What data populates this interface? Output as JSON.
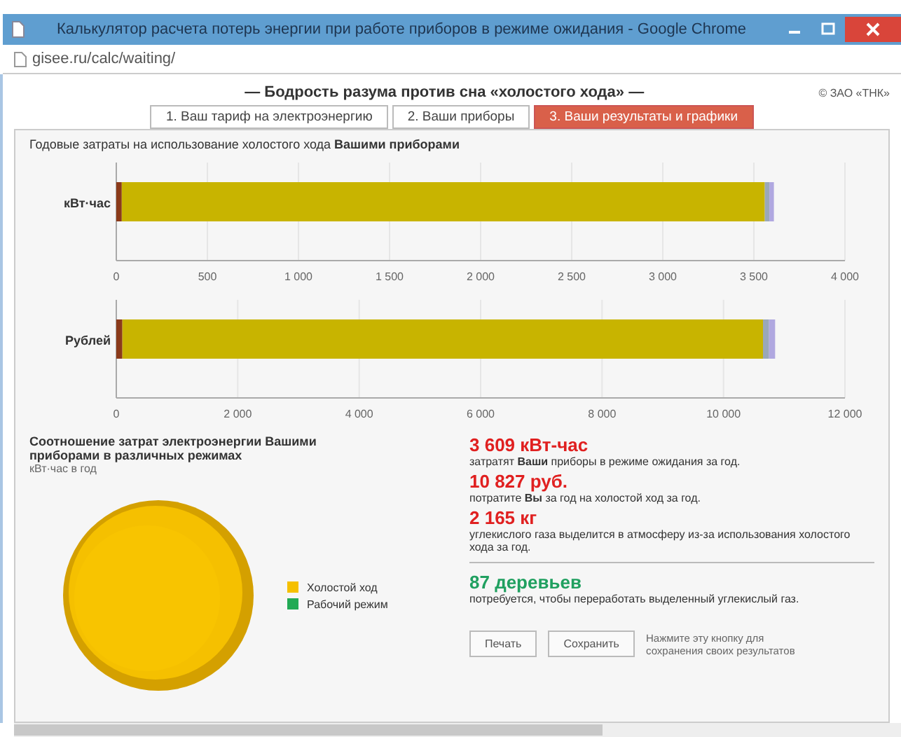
{
  "window": {
    "title": "Калькулятор расчета потерь энергии при работе приборов в режиме ожидания - Google Chrome"
  },
  "address_bar": {
    "url": "gisee.ru/calc/waiting/"
  },
  "page": {
    "heading": "— Бодрость разума против сна «холостого хода» —",
    "corner_text": "© ЗАО «ТНК»",
    "tabs": [
      {
        "label": "1. Ваш тариф на электроэнергию",
        "selected": false
      },
      {
        "label": "2. Ваши приборы",
        "selected": false
      },
      {
        "label": "3. Ваши результаты и графики",
        "selected": true
      }
    ],
    "bar_section": {
      "title": "Годовые затраты на использование холостого хода **Вашими приборами**",
      "charts": [
        {
          "chart_data": {
            "type": "bar",
            "orientation": "horizontal",
            "stacked": true,
            "grid": true,
            "categories": [
              "кВт·час"
            ],
            "xlim": [
              0,
              4000
            ],
            "xticks": [
              {
                "value": 0,
                "label": "0"
              },
              {
                "value": 500,
                "label": "500"
              },
              {
                "value": 1000,
                "label": "1 000"
              },
              {
                "value": 1500,
                "label": "1 500"
              },
              {
                "value": 2000,
                "label": "2 000"
              },
              {
                "value": 2500,
                "label": "2 500"
              },
              {
                "value": 3000,
                "label": "3 000"
              },
              {
                "value": 3500,
                "label": "3 500"
              },
              {
                "value": 4000,
                "label": "4 000"
              }
            ],
            "series": [
              {
                "color": "#8b3a1a",
                "values": [
                  30
                ]
              },
              {
                "color": "#c8b400",
                "values": [
                  3530
                ]
              },
              {
                "color": "#9aa8b8",
                "values": [
                  25
                ]
              },
              {
                "color": "#b0a8e0",
                "values": [
                  25
                ]
              }
            ]
          }
        },
        {
          "chart_data": {
            "type": "bar",
            "orientation": "horizontal",
            "stacked": true,
            "grid": true,
            "categories": [
              "Рублей"
            ],
            "xlim": [
              0,
              12000
            ],
            "xticks": [
              {
                "value": 0,
                "label": "0"
              },
              {
                "value": 2000,
                "label": "2 000"
              },
              {
                "value": 4000,
                "label": "4 000"
              },
              {
                "value": 6000,
                "label": "6 000"
              },
              {
                "value": 8000,
                "label": "8 000"
              },
              {
                "value": 10000,
                "label": "10 000"
              },
              {
                "value": 12000,
                "label": "12 000"
              }
            ],
            "series": [
              {
                "color": "#8b3a1a",
                "values": [
                  100
                ]
              },
              {
                "color": "#c8b400",
                "values": [
                  10550
                ]
              },
              {
                "color": "#9aa8b8",
                "values": [
                  100
                ]
              },
              {
                "color": "#b0a8e0",
                "values": [
                  100
                ]
              }
            ]
          }
        }
      ]
    },
    "pie_section": {
      "title": "Соотношение затрат электроэнергии Вашими приборами в различных режимах",
      "subtitle": "кВт·час в год",
      "legend": [
        {
          "label": "Холостой ход",
          "color": "#f5c000"
        },
        {
          "label": "Рабочий режим",
          "color": "#22aa55"
        }
      ]
    },
    "results": [
      {
        "value": "3 609 кВт-час",
        "text": "затратят **Ваши** приборы в режиме ожидания за год.",
        "kind": "loss"
      },
      {
        "value": "10 827 руб.",
        "text": "потратите **Вы** за год на холостой ход за год.",
        "kind": "loss"
      },
      {
        "value": "2 165 кг",
        "text": "углекислого газа выделится в атмосферу из-за использования холостого хода за год.",
        "kind": "loss"
      },
      {
        "value": "87 деревьев",
        "text": "потребуется, чтобы переработать выделенный углекислый газ.",
        "kind": "offset"
      }
    ],
    "buttons": [
      {
        "label": "Печать"
      },
      {
        "label": "Сохранить"
      }
    ],
    "save_hint": "Нажмите эту кнопку для сохранения своих результатов"
  }
}
